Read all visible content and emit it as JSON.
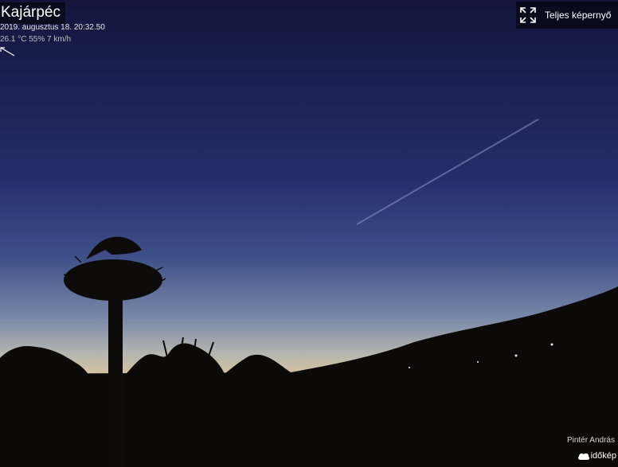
{
  "camera": {
    "location": "Kajárpéc",
    "datetime": "2019. augusztus 18. 20:32.50",
    "weather": "26.1 °C 55% 7 km/h",
    "wind_icon": "wind-direction-arrow-icon"
  },
  "controls": {
    "fullscreen_label": "Teljes képernyő",
    "fullscreen_icon": "expand-icon"
  },
  "credit": {
    "photographer": "Pintér András",
    "brand": "időkép",
    "brand_icon": "cloud-logo-icon"
  }
}
